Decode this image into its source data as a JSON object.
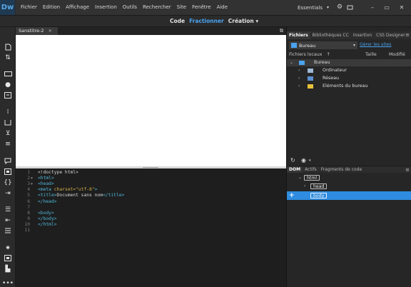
{
  "app": {
    "logo": "Dw"
  },
  "menu": [
    "Fichier",
    "Edition",
    "Affichage",
    "Insertion",
    "Outils",
    "Rechercher",
    "Site",
    "Fenêtre",
    "Aide"
  ],
  "workspace": {
    "label": "Essentials"
  },
  "views": {
    "code": "Code",
    "split": "Fractionner",
    "design": "Création",
    "design_caret": "▾"
  },
  "document": {
    "tab_title": "Sanstitre-2",
    "tab_close": "×"
  },
  "code_lines": [
    {
      "n": "1",
      "fold": "",
      "parts": [
        {
          "t": "<!doctype html>",
          "c": "c-doctype"
        }
      ]
    },
    {
      "n": "2",
      "fold": "▼",
      "parts": [
        {
          "t": "<html>",
          "c": "c-tag"
        }
      ]
    },
    {
      "n": "3",
      "fold": "▼",
      "parts": [
        {
          "t": "<head>",
          "c": "c-tag"
        }
      ]
    },
    {
      "n": "4",
      "fold": "",
      "parts": [
        {
          "t": "<meta ",
          "c": "c-tag"
        },
        {
          "t": "charset=",
          "c": "c-attr"
        },
        {
          "t": "\"utf-8\"",
          "c": "c-str"
        },
        {
          "t": ">",
          "c": "c-tag"
        }
      ]
    },
    {
      "n": "5",
      "fold": "",
      "parts": [
        {
          "t": "<title>",
          "c": "c-tag"
        },
        {
          "t": "Document sans nom",
          "c": "c-txt"
        },
        {
          "t": "</title>",
          "c": "c-tag"
        }
      ]
    },
    {
      "n": "6",
      "fold": "",
      "parts": [
        {
          "t": "</head>",
          "c": "c-tag"
        }
      ]
    },
    {
      "n": "7",
      "fold": "",
      "parts": []
    },
    {
      "n": "8",
      "fold": "",
      "parts": [
        {
          "t": "<body>",
          "c": "c-tag"
        }
      ]
    },
    {
      "n": "9",
      "fold": "",
      "parts": [
        {
          "t": "</body>",
          "c": "c-tag"
        }
      ]
    },
    {
      "n": "10",
      "fold": "",
      "parts": [
        {
          "t": "</html>",
          "c": "c-tag"
        }
      ]
    },
    {
      "n": "11",
      "fold": "",
      "parts": []
    }
  ],
  "files_panel": {
    "tabs": [
      "Fichiers",
      "Bibliothèques CC",
      "Insertion",
      "CSS Designer"
    ],
    "site": "Bureau",
    "manage_link": "Gérer les sites",
    "col_local": "Fichiers locaux",
    "col_sort": "↑",
    "col_size": "Taille",
    "col_modified": "Modifié",
    "tree": [
      {
        "label": "Bureau",
        "chev": "⌄",
        "level": 0,
        "icon": "desktop"
      },
      {
        "label": "Ordinateur",
        "chev": "›",
        "level": 1,
        "icon": "computer"
      },
      {
        "label": "Réseau",
        "chev": "›",
        "level": 1,
        "icon": "network"
      },
      {
        "label": "Eléments du bureau",
        "chev": "›",
        "level": 1,
        "icon": "folder"
      }
    ]
  },
  "dom_panel": {
    "tabs": [
      "DOM",
      "Actifs",
      "Fragments de code"
    ],
    "nodes": [
      {
        "label": "html",
        "chev": "⌄"
      },
      {
        "label": "head",
        "chev": "›"
      },
      {
        "label": "body",
        "chev": ""
      }
    ],
    "plus": "+"
  },
  "colors": {
    "accent": "#2f8ce0",
    "link": "#4aa3f0"
  }
}
